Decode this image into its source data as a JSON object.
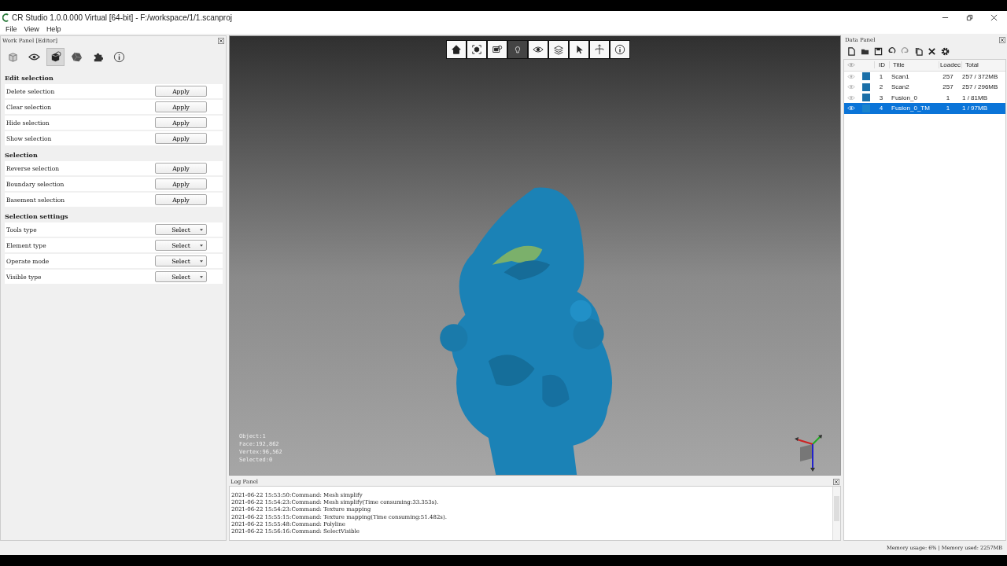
{
  "window": {
    "title": "CR Studio 1.0.0.000 Virtual [64-bit] - F:/workspace/1/1.scanproj"
  },
  "menu": [
    "File",
    "View",
    "Help"
  ],
  "work_panel": {
    "title": "Work Panel [Editor]",
    "tabs": [
      {
        "selected": false
      },
      {
        "selected": false
      },
      {
        "selected": true
      },
      {
        "selected": false
      },
      {
        "selected": false
      },
      {
        "selected": false
      }
    ],
    "sections": [
      {
        "title": "Edit selection",
        "rows": [
          {
            "label": "Delete selection",
            "kind": "apply",
            "control": "Apply"
          },
          {
            "label": "Clear selection",
            "kind": "apply",
            "control": "Apply"
          },
          {
            "label": "Hide selection",
            "kind": "apply",
            "control": "Apply"
          },
          {
            "label": "Show selection",
            "kind": "apply",
            "control": "Apply"
          }
        ]
      },
      {
        "title": "Selection",
        "rows": [
          {
            "label": "Reverse selection",
            "kind": "apply",
            "control": "Apply"
          },
          {
            "label": "Boundary selection",
            "kind": "apply",
            "control": "Apply"
          },
          {
            "label": "Basement selection",
            "kind": "apply",
            "control": "Apply"
          }
        ]
      },
      {
        "title": "Selection settings",
        "rows": [
          {
            "label": "Tools type",
            "kind": "select",
            "control": "Select"
          },
          {
            "label": "Element type",
            "kind": "select",
            "control": "Select"
          },
          {
            "label": "Operate mode",
            "kind": "select",
            "control": "Select"
          },
          {
            "label": "Visible type",
            "kind": "select",
            "control": "Select"
          }
        ]
      }
    ]
  },
  "viewport": {
    "tools": [
      {
        "selected": false
      },
      {
        "selected": false
      },
      {
        "selected": false
      },
      {
        "selected": true
      },
      {
        "selected": false
      },
      {
        "selected": false
      },
      {
        "selected": false
      },
      {
        "selected": false
      },
      {
        "selected": false
      }
    ],
    "stats": [
      "Object:1",
      "Face:192,862",
      "Vertex:96,562",
      "Selected:0"
    ]
  },
  "log_panel": {
    "title": "Log Panel",
    "lines": [
      "2021-06-22 15:53:50:Command: Mesh simplify",
      "2021-06-22 15:54:23:Command: Mesh simplify(Time consuming:33.353s).",
      "2021-06-22 15:54:23:Command: Texture mapping",
      "2021-06-22 15:55:15:Command: Texture mapping(Time consuming:51.482s).",
      "2021-06-22 15:55:48:Command: Polyline",
      "2021-06-22 15:56:16:Command: SelectVisible"
    ]
  },
  "data_panel": {
    "title": "Data Panel",
    "columns": [
      "ID",
      "Title",
      "Loadec",
      "Total"
    ],
    "rows": [
      {
        "id": "1",
        "title": "Scan1",
        "loaded": "257",
        "total": "257 / 372MB",
        "color": "#1a6fa8",
        "selected": false
      },
      {
        "id": "2",
        "title": "Scan2",
        "loaded": "257",
        "total": "257 / 296MB",
        "color": "#1a6fa8",
        "selected": false
      },
      {
        "id": "3",
        "title": "Fusion_0",
        "loaded": "1",
        "total": "1 / 81MB",
        "color": "#1a6fa8",
        "selected": false
      },
      {
        "id": "4",
        "title": "Fusion_0_TM",
        "loaded": "1",
        "total": "1 / 97MB",
        "color": "#1a84cc",
        "selected": true
      }
    ]
  },
  "status_bar": "Memory usage: 6% | Memory used: 2257MB"
}
